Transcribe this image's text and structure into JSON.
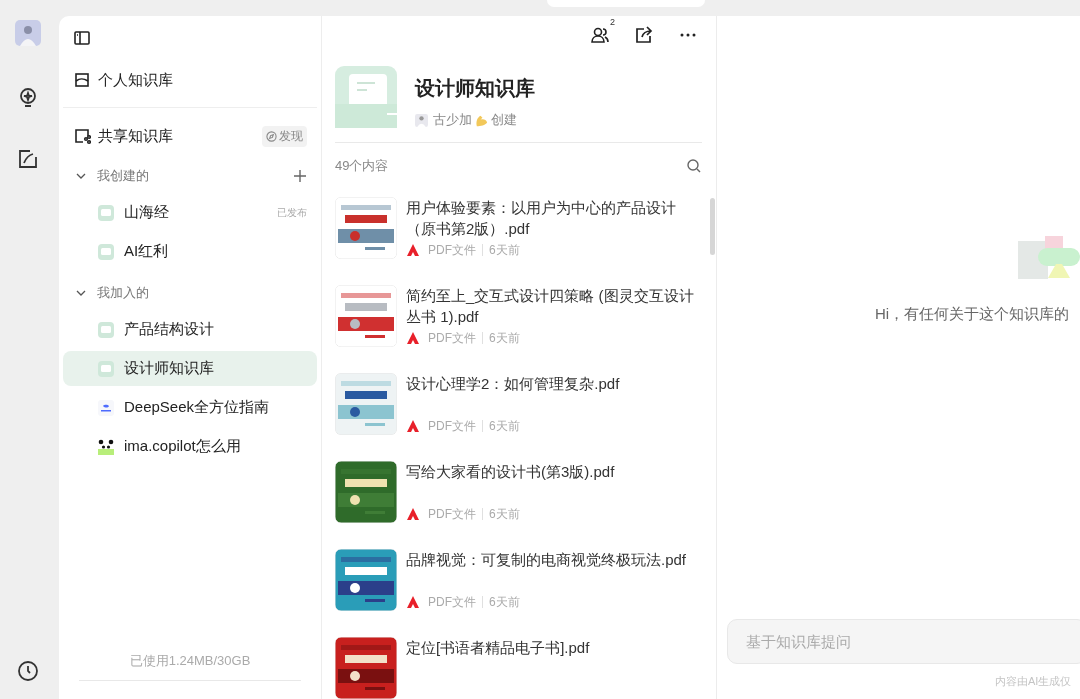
{
  "sidebar": {
    "personal": {
      "label": "个人知识库"
    },
    "shared": {
      "label": "共享知识库",
      "discover": "发现"
    },
    "groups": [
      {
        "label": "我创建的",
        "expanded": true,
        "can_add": true,
        "items": [
          {
            "label": "山海经",
            "kind": "library",
            "badge": "已发布",
            "selected": false
          },
          {
            "label": "AI红利",
            "kind": "library",
            "selected": false
          }
        ]
      },
      {
        "label": "我加入的",
        "expanded": true,
        "can_add": false,
        "items": [
          {
            "label": "产品结构设计",
            "kind": "library",
            "selected": false
          },
          {
            "label": "设计师知识库",
            "kind": "library",
            "selected": true
          },
          {
            "label": "DeepSeek全方位指南",
            "kind": "deepseek",
            "selected": false
          },
          {
            "label": "ima.copilot怎么用",
            "kind": "panda",
            "selected": false
          }
        ]
      }
    ],
    "storage": "已使用1.24MB/30GB"
  },
  "toolbar": {
    "members_count": "2"
  },
  "library": {
    "title": "设计师知识库",
    "creator": "古少加",
    "creator_suffix": "创建",
    "count": "49个内容"
  },
  "files": [
    {
      "title": "用户体验要素：以用户为中心的产品设计（原书第2版）.pdf",
      "type": "PDF文件",
      "time": "6天前"
    },
    {
      "title": "简约至上_交互式设计四策略 (图灵交互设计丛书 1).pdf",
      "type": "PDF文件",
      "time": "6天前"
    },
    {
      "title": "设计心理学2：如何管理复杂.pdf",
      "type": "PDF文件",
      "time": "6天前"
    },
    {
      "title": "写给大家看的设计书(第3版).pdf",
      "type": "PDF文件",
      "time": "6天前"
    },
    {
      "title": "品牌视觉：可复制的电商视觉终极玩法.pdf",
      "type": "PDF文件",
      "time": "6天前"
    },
    {
      "title": "定位[书语者精品电子书].pdf"
    }
  ],
  "chat": {
    "greeting": "Hi，有任何关于这个知识库的",
    "input": {
      "placeholder": "基于知识库提问"
    },
    "disclaimer": "内容由AI生成仅"
  }
}
